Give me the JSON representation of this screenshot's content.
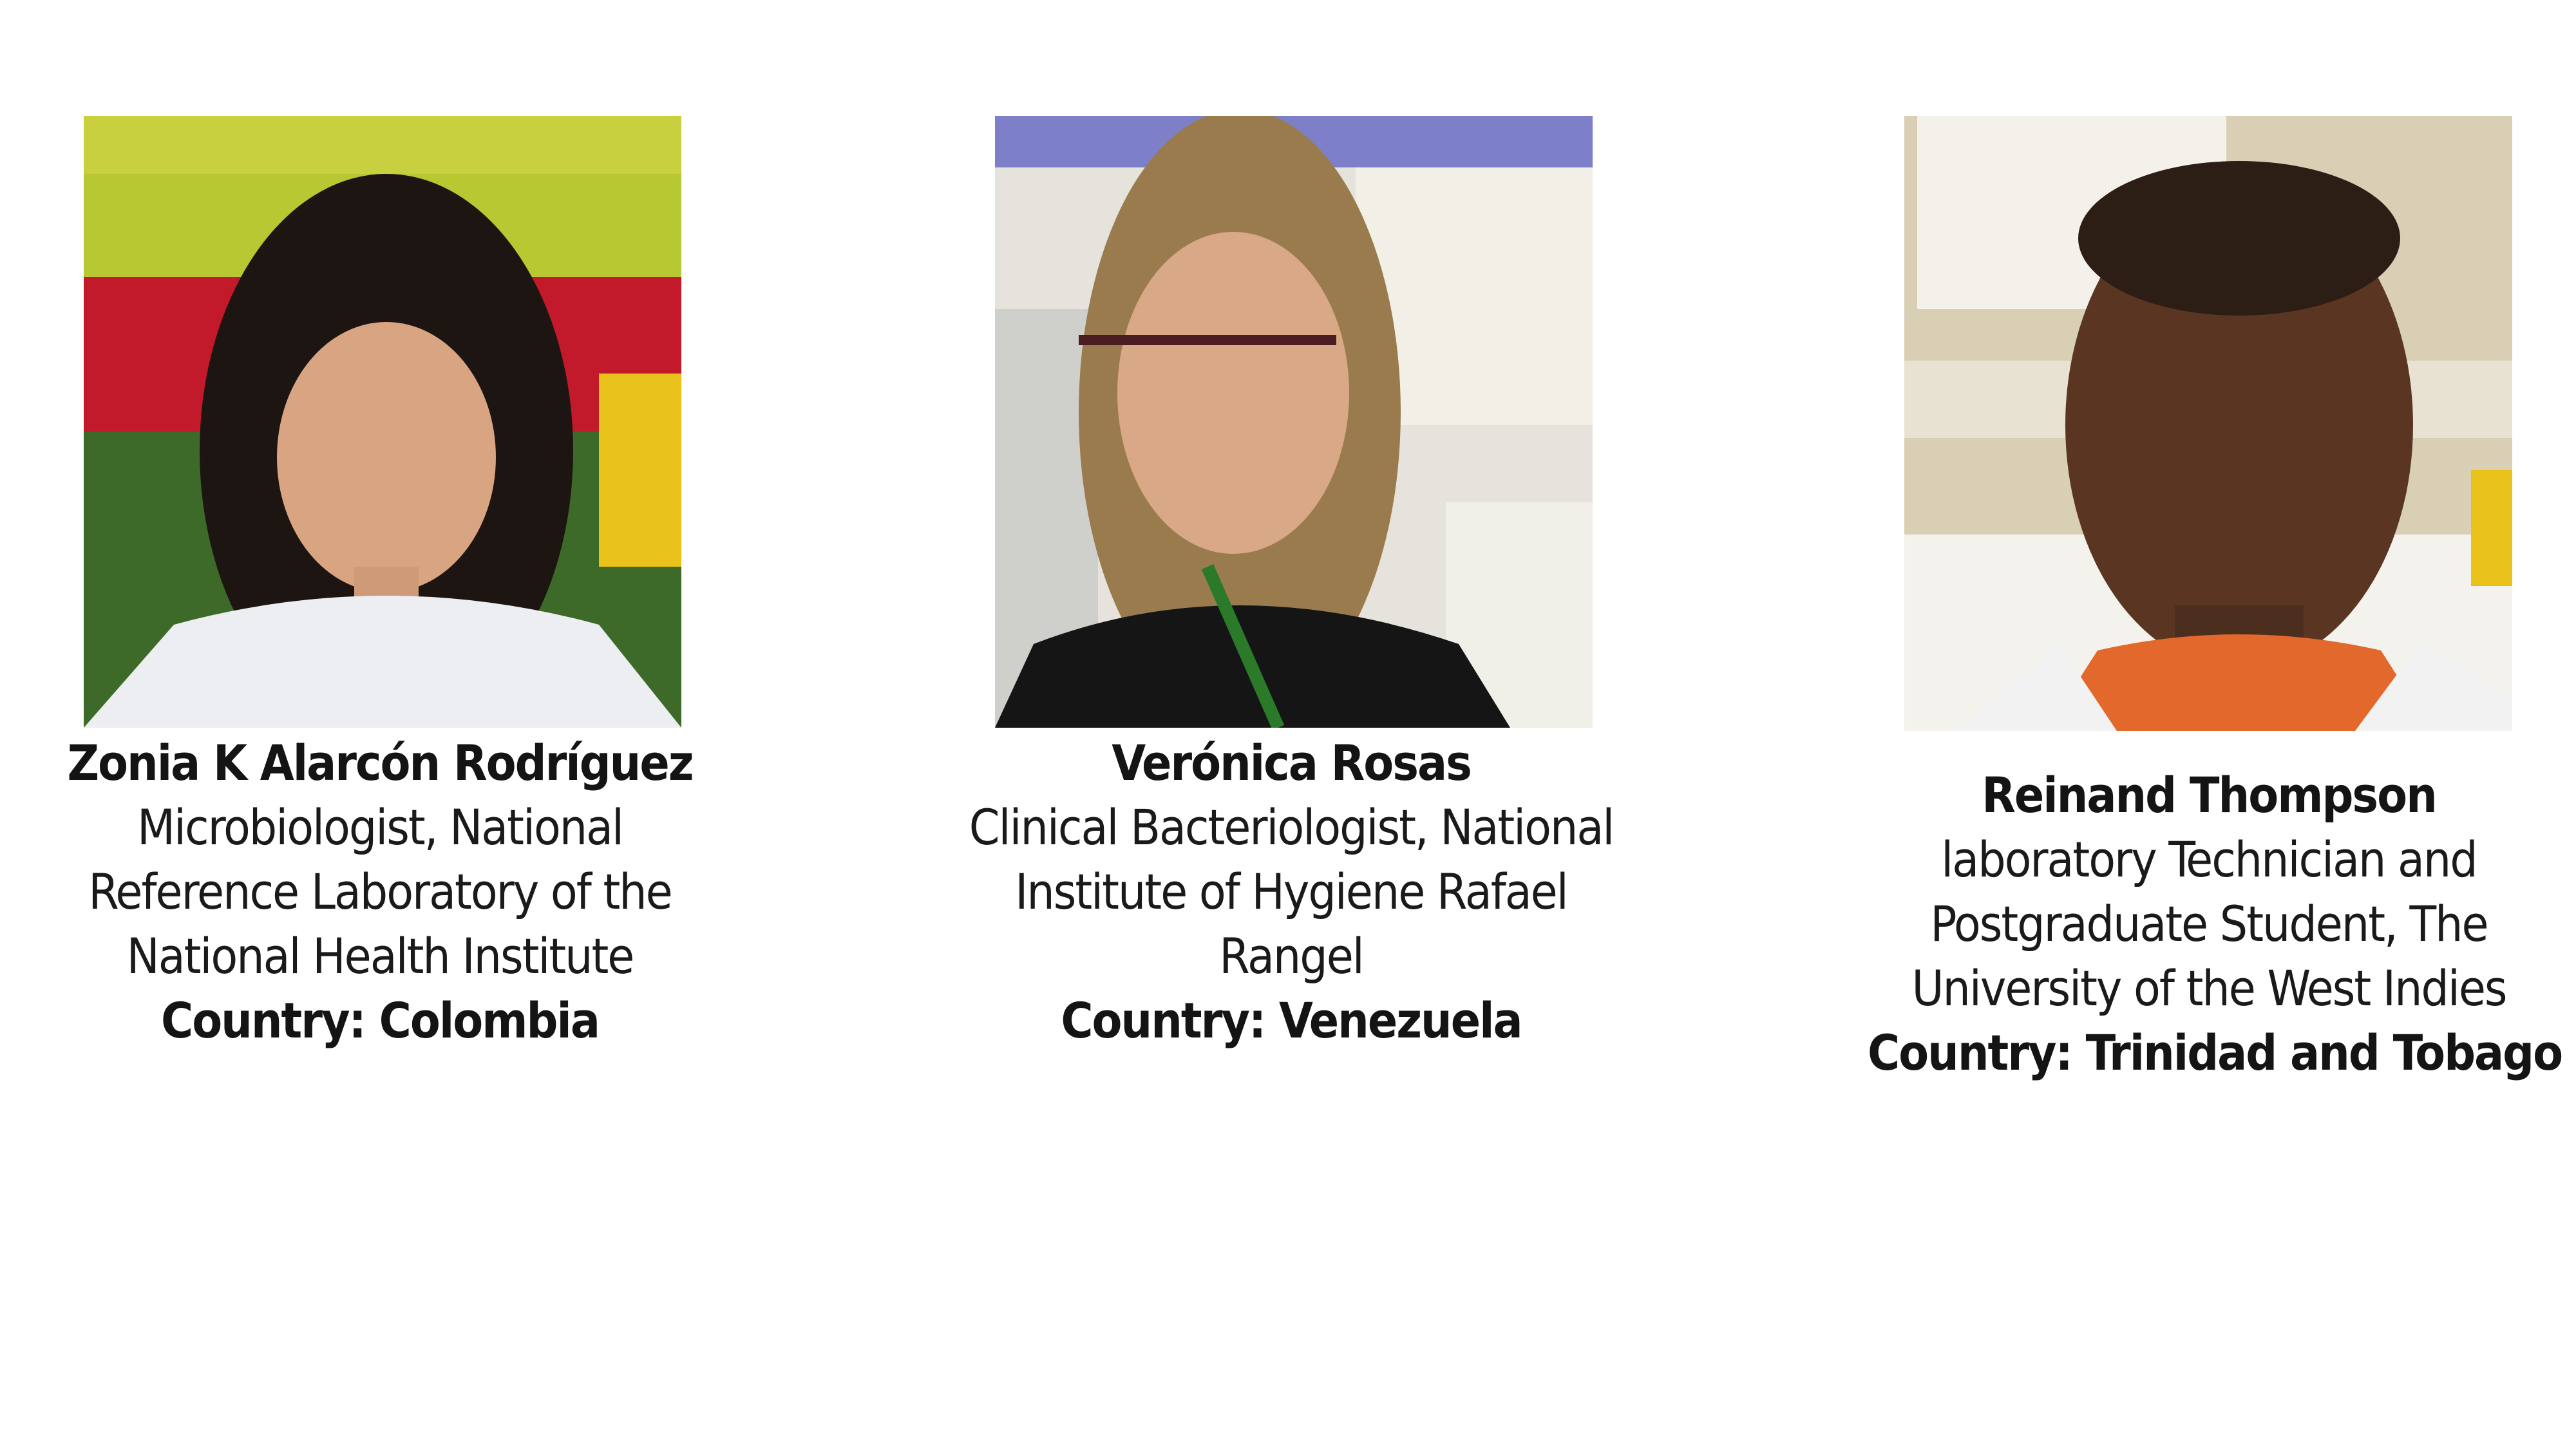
{
  "people": [
    {
      "name": "Zonia K Alarcón Rodríguez",
      "role_lines": [
        "Microbiologist, National",
        "Reference Laboratory of the",
        "National Health Institute"
      ],
      "country": "Country: Colombia"
    },
    {
      "name": "Verónica Rosas",
      "role_lines": [
        "Clinical Bacteriologist, National",
        "Institute of Hygiene Rafael",
        "Rangel"
      ],
      "country": "Country: Venezuela"
    },
    {
      "name": "Reinand Thompson",
      "role_lines": [
        "laboratory Technician and",
        "Postgraduate Student, The",
        "University of the West Indies"
      ],
      "country": "Country: Trinidad and Tobago"
    }
  ],
  "colors": {
    "background": "#ffffff",
    "text": "#141414"
  }
}
